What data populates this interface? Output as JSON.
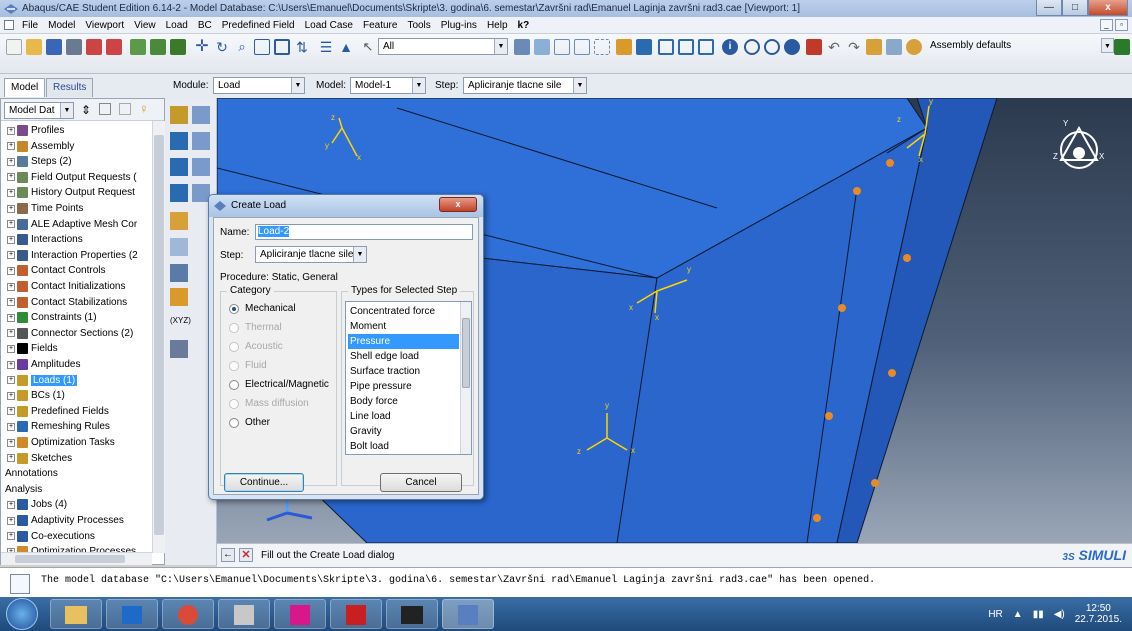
{
  "window": {
    "title": "Abaqus/CAE Student Edition 6.14-2 - Model Database: C:\\Users\\Emanuel\\Documents\\Skripte\\3. godina\\6. semestar\\Završni rad\\Emanuel Laginja završni rad3.cae [Viewport: 1]",
    "controls": [
      "—",
      "□",
      "x"
    ]
  },
  "menubar": {
    "items": [
      "File",
      "Model",
      "Viewport",
      "View",
      "Load",
      "BC",
      "Predefined Field",
      "Load Case",
      "Feature",
      "Tools",
      "Plug-ins",
      "Help",
      "k?"
    ]
  },
  "toolbar": {
    "selection_filter": "All",
    "render_style": "Assembly defaults"
  },
  "context": {
    "tab_model": "Model",
    "tab_results": "Results",
    "module_label": "Module:",
    "module_value": "Load",
    "model_label": "Model:",
    "model_value": "Model-1",
    "step_label": "Step:",
    "step_value": "Apliciranje tlacne sile"
  },
  "tree": {
    "header_value": "Model Dat",
    "items": [
      {
        "label": "Profiles",
        "icon_color": "#7a4a8a"
      },
      {
        "label": "Assembly",
        "icon_color": "#c4872a"
      },
      {
        "label": "Steps (2)",
        "icon_color": "#5a7a9a"
      },
      {
        "label": "Field Output Requests (",
        "icon_color": "#6a8a5a"
      },
      {
        "label": "History Output Request",
        "icon_color": "#6a8a5a"
      },
      {
        "label": "Time Points",
        "icon_color": "#8a6a4a"
      },
      {
        "label": "ALE Adaptive Mesh Cor",
        "icon_color": "#4a6a9a"
      },
      {
        "label": "Interactions",
        "icon_color": "#3a5a8a"
      },
      {
        "label": "Interaction Properties (2",
        "icon_color": "#3a5a8a"
      },
      {
        "label": "Contact Controls",
        "icon_color": "#c06030"
      },
      {
        "label": "Contact Initializations",
        "icon_color": "#c06030"
      },
      {
        "label": "Contact Stabilizations",
        "icon_color": "#c06030"
      },
      {
        "label": "Constraints (1)",
        "icon_color": "#2f8a3a"
      },
      {
        "label": "Connector Sections (2)",
        "icon_color": "#555555"
      },
      {
        "label": "Fields",
        "icon_color": "#000000"
      },
      {
        "label": "Amplitudes",
        "icon_color": "#6a3aa0"
      },
      {
        "label": "Loads (1)",
        "icon_color": "#c49a2a"
      },
      {
        "label": "BCs (1)",
        "icon_color": "#c49a2a"
      },
      {
        "label": "Predefined Fields",
        "icon_color": "#c49a2a"
      },
      {
        "label": "Remeshing Rules",
        "icon_color": "#2a6ab0"
      },
      {
        "label": "Optimization Tasks",
        "icon_color": "#d08a2a"
      },
      {
        "label": "Sketches",
        "icon_color": "#c49a2a"
      },
      {
        "label": "Annotations",
        "icon_color": ""
      },
      {
        "label": "Analysis",
        "icon_color": ""
      },
      {
        "label": "Jobs (4)",
        "icon_color": "#2a5aa0"
      },
      {
        "label": "Adaptivity Processes",
        "icon_color": "#2a5aa0"
      },
      {
        "label": "Co-executions",
        "icon_color": "#2a5aa0"
      },
      {
        "label": "Optimization Processes",
        "icon_color": "#d08a2a"
      }
    ]
  },
  "dialog": {
    "title": "Create Load",
    "name_label": "Name:",
    "name_value": "Load-2",
    "step_label": "Step:",
    "step_value": "Apliciranje tlacne sile",
    "procedure_text": "Procedure:  Static, General",
    "category_title": "Category",
    "categories": [
      {
        "label": "Mechanical",
        "state": "on"
      },
      {
        "label": "Thermal",
        "state": "disabled"
      },
      {
        "label": "Acoustic",
        "state": "disabled"
      },
      {
        "label": "Fluid",
        "state": "disabled"
      },
      {
        "label": "Electrical/Magnetic",
        "state": "off"
      },
      {
        "label": "Mass diffusion",
        "state": "disabled"
      },
      {
        "label": "Other",
        "state": "off"
      }
    ],
    "types_title": "Types for Selected Step",
    "types": [
      "Concentrated force",
      "Moment",
      "Pressure",
      "Shell edge load",
      "Surface traction",
      "Pipe pressure",
      "Body force",
      "Line load",
      "Gravity",
      "Bolt load"
    ],
    "selected_type": "Pressure",
    "continue_label": "Continue...",
    "cancel_label": "Cancel"
  },
  "prompt": {
    "text": "Fill out the Create Load dialog"
  },
  "message": {
    "text": "The model database \"C:\\Users\\Emanuel\\Documents\\Skripte\\3. godina\\6. semestar\\Završni rad\\Emanuel Laginja završni rad3.cae\" has been opened."
  },
  "viewport": {
    "brand": "SIMULI",
    "brand_prefix": "3S",
    "triad_labels": [
      "Y",
      "Z",
      "X"
    ],
    "mesh_color": "#2f6fd8"
  },
  "taskbar": {
    "lang": "HR",
    "time": "12:50",
    "date": "22.7.2015."
  }
}
